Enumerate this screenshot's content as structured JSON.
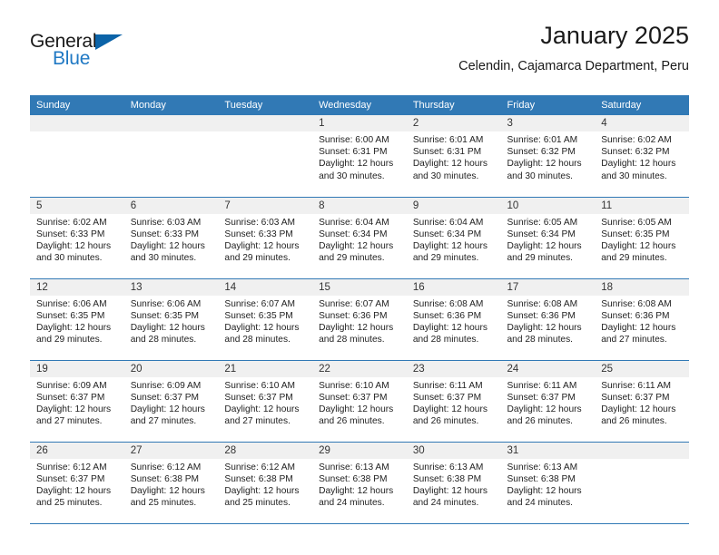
{
  "brand": {
    "word1": "General",
    "word2": "Blue",
    "accent_color": "#2079c4",
    "triangle_color": "#0b63a8",
    "logo_icon": "triangle-flag-icon"
  },
  "header": {
    "title": "January 2025",
    "subtitle": "Celendin, Cajamarca Department, Peru"
  },
  "calendar": {
    "header_bg": "#3179b5",
    "header_text_color": "#ffffff",
    "daynum_bg": "#f0f0f0",
    "weekdays": [
      "Sunday",
      "Monday",
      "Tuesday",
      "Wednesday",
      "Thursday",
      "Friday",
      "Saturday"
    ],
    "weeks": [
      [
        {
          "day": "",
          "sunrise": "",
          "sunset": "",
          "daylight1": "",
          "daylight2": "",
          "blank": true
        },
        {
          "day": "",
          "sunrise": "",
          "sunset": "",
          "daylight1": "",
          "daylight2": "",
          "blank": true
        },
        {
          "day": "",
          "sunrise": "",
          "sunset": "",
          "daylight1": "",
          "daylight2": "",
          "blank": true
        },
        {
          "day": "1",
          "sunrise": "Sunrise: 6:00 AM",
          "sunset": "Sunset: 6:31 PM",
          "daylight1": "Daylight: 12 hours",
          "daylight2": "and 30 minutes."
        },
        {
          "day": "2",
          "sunrise": "Sunrise: 6:01 AM",
          "sunset": "Sunset: 6:31 PM",
          "daylight1": "Daylight: 12 hours",
          "daylight2": "and 30 minutes."
        },
        {
          "day": "3",
          "sunrise": "Sunrise: 6:01 AM",
          "sunset": "Sunset: 6:32 PM",
          "daylight1": "Daylight: 12 hours",
          "daylight2": "and 30 minutes."
        },
        {
          "day": "4",
          "sunrise": "Sunrise: 6:02 AM",
          "sunset": "Sunset: 6:32 PM",
          "daylight1": "Daylight: 12 hours",
          "daylight2": "and 30 minutes."
        }
      ],
      [
        {
          "day": "5",
          "sunrise": "Sunrise: 6:02 AM",
          "sunset": "Sunset: 6:33 PM",
          "daylight1": "Daylight: 12 hours",
          "daylight2": "and 30 minutes."
        },
        {
          "day": "6",
          "sunrise": "Sunrise: 6:03 AM",
          "sunset": "Sunset: 6:33 PM",
          "daylight1": "Daylight: 12 hours",
          "daylight2": "and 30 minutes."
        },
        {
          "day": "7",
          "sunrise": "Sunrise: 6:03 AM",
          "sunset": "Sunset: 6:33 PM",
          "daylight1": "Daylight: 12 hours",
          "daylight2": "and 29 minutes."
        },
        {
          "day": "8",
          "sunrise": "Sunrise: 6:04 AM",
          "sunset": "Sunset: 6:34 PM",
          "daylight1": "Daylight: 12 hours",
          "daylight2": "and 29 minutes."
        },
        {
          "day": "9",
          "sunrise": "Sunrise: 6:04 AM",
          "sunset": "Sunset: 6:34 PM",
          "daylight1": "Daylight: 12 hours",
          "daylight2": "and 29 minutes."
        },
        {
          "day": "10",
          "sunrise": "Sunrise: 6:05 AM",
          "sunset": "Sunset: 6:34 PM",
          "daylight1": "Daylight: 12 hours",
          "daylight2": "and 29 minutes."
        },
        {
          "day": "11",
          "sunrise": "Sunrise: 6:05 AM",
          "sunset": "Sunset: 6:35 PM",
          "daylight1": "Daylight: 12 hours",
          "daylight2": "and 29 minutes."
        }
      ],
      [
        {
          "day": "12",
          "sunrise": "Sunrise: 6:06 AM",
          "sunset": "Sunset: 6:35 PM",
          "daylight1": "Daylight: 12 hours",
          "daylight2": "and 29 minutes."
        },
        {
          "day": "13",
          "sunrise": "Sunrise: 6:06 AM",
          "sunset": "Sunset: 6:35 PM",
          "daylight1": "Daylight: 12 hours",
          "daylight2": "and 28 minutes."
        },
        {
          "day": "14",
          "sunrise": "Sunrise: 6:07 AM",
          "sunset": "Sunset: 6:35 PM",
          "daylight1": "Daylight: 12 hours",
          "daylight2": "and 28 minutes."
        },
        {
          "day": "15",
          "sunrise": "Sunrise: 6:07 AM",
          "sunset": "Sunset: 6:36 PM",
          "daylight1": "Daylight: 12 hours",
          "daylight2": "and 28 minutes."
        },
        {
          "day": "16",
          "sunrise": "Sunrise: 6:08 AM",
          "sunset": "Sunset: 6:36 PM",
          "daylight1": "Daylight: 12 hours",
          "daylight2": "and 28 minutes."
        },
        {
          "day": "17",
          "sunrise": "Sunrise: 6:08 AM",
          "sunset": "Sunset: 6:36 PM",
          "daylight1": "Daylight: 12 hours",
          "daylight2": "and 28 minutes."
        },
        {
          "day": "18",
          "sunrise": "Sunrise: 6:08 AM",
          "sunset": "Sunset: 6:36 PM",
          "daylight1": "Daylight: 12 hours",
          "daylight2": "and 27 minutes."
        }
      ],
      [
        {
          "day": "19",
          "sunrise": "Sunrise: 6:09 AM",
          "sunset": "Sunset: 6:37 PM",
          "daylight1": "Daylight: 12 hours",
          "daylight2": "and 27 minutes."
        },
        {
          "day": "20",
          "sunrise": "Sunrise: 6:09 AM",
          "sunset": "Sunset: 6:37 PM",
          "daylight1": "Daylight: 12 hours",
          "daylight2": "and 27 minutes."
        },
        {
          "day": "21",
          "sunrise": "Sunrise: 6:10 AM",
          "sunset": "Sunset: 6:37 PM",
          "daylight1": "Daylight: 12 hours",
          "daylight2": "and 27 minutes."
        },
        {
          "day": "22",
          "sunrise": "Sunrise: 6:10 AM",
          "sunset": "Sunset: 6:37 PM",
          "daylight1": "Daylight: 12 hours",
          "daylight2": "and 26 minutes."
        },
        {
          "day": "23",
          "sunrise": "Sunrise: 6:11 AM",
          "sunset": "Sunset: 6:37 PM",
          "daylight1": "Daylight: 12 hours",
          "daylight2": "and 26 minutes."
        },
        {
          "day": "24",
          "sunrise": "Sunrise: 6:11 AM",
          "sunset": "Sunset: 6:37 PM",
          "daylight1": "Daylight: 12 hours",
          "daylight2": "and 26 minutes."
        },
        {
          "day": "25",
          "sunrise": "Sunrise: 6:11 AM",
          "sunset": "Sunset: 6:37 PM",
          "daylight1": "Daylight: 12 hours",
          "daylight2": "and 26 minutes."
        }
      ],
      [
        {
          "day": "26",
          "sunrise": "Sunrise: 6:12 AM",
          "sunset": "Sunset: 6:37 PM",
          "daylight1": "Daylight: 12 hours",
          "daylight2": "and 25 minutes."
        },
        {
          "day": "27",
          "sunrise": "Sunrise: 6:12 AM",
          "sunset": "Sunset: 6:38 PM",
          "daylight1": "Daylight: 12 hours",
          "daylight2": "and 25 minutes."
        },
        {
          "day": "28",
          "sunrise": "Sunrise: 6:12 AM",
          "sunset": "Sunset: 6:38 PM",
          "daylight1": "Daylight: 12 hours",
          "daylight2": "and 25 minutes."
        },
        {
          "day": "29",
          "sunrise": "Sunrise: 6:13 AM",
          "sunset": "Sunset: 6:38 PM",
          "daylight1": "Daylight: 12 hours",
          "daylight2": "and 24 minutes."
        },
        {
          "day": "30",
          "sunrise": "Sunrise: 6:13 AM",
          "sunset": "Sunset: 6:38 PM",
          "daylight1": "Daylight: 12 hours",
          "daylight2": "and 24 minutes."
        },
        {
          "day": "31",
          "sunrise": "Sunrise: 6:13 AM",
          "sunset": "Sunset: 6:38 PM",
          "daylight1": "Daylight: 12 hours",
          "daylight2": "and 24 minutes."
        },
        {
          "day": "",
          "sunrise": "",
          "sunset": "",
          "daylight1": "",
          "daylight2": "",
          "blank": true
        }
      ]
    ]
  }
}
